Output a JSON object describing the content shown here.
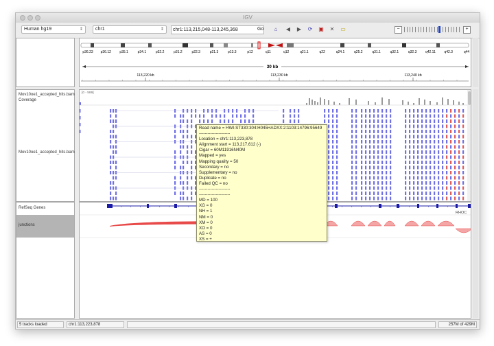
{
  "window": {
    "title": "IGV"
  },
  "toolbar": {
    "genome": "Human hg19",
    "chromosome": "chr1",
    "locus": "chr1:113,215,048-113,245,368",
    "go_label": "Go",
    "zoom_minus": "−",
    "zoom_plus": "+"
  },
  "ruler": {
    "bands": [
      "p36.23",
      "p36.12",
      "p35.1",
      "p34.1",
      "p32.2",
      "p31.2",
      "p22.3",
      "p21.3",
      "p13.3",
      "p12",
      "q11",
      "q12",
      "q21.1",
      "q22",
      "q24.1",
      "q25.2",
      "q31.1",
      "q32.1",
      "q32.3",
      "q42.11",
      "q42.3",
      "q44"
    ],
    "span_label": "30 kb",
    "ticks": [
      "113,220 kb",
      "113,230 kb",
      "113,240 kb"
    ]
  },
  "tracks": {
    "coverage_name": "Mov10oe1_accepted_hits.bam Coverage",
    "coverage_range": "[0 - 589]",
    "alignment_name": "Mov10oe1_accepted_hits.bam",
    "refseq_name": "RefSeq Genes",
    "junctions_name": "junctions",
    "gene_label": "RHOC"
  },
  "popup": {
    "lines": [
      "Read name = HWI-ST330:304:H045HADXX:2:1103:14796:95649",
      "----------------------",
      "Location = chr1:113,223,878",
      "Alignment start = 113,217,612 (-)",
      "Cigar = 60M11916N40M",
      "Mapped = yes",
      "Mapping quality = 50",
      "Secondary = no",
      "Supplementary = no",
      "Duplicate = no",
      "Failed QC = no",
      "----------------------",
      "----------------------",
      "MD = 100",
      "XG = 0",
      "NH = 1",
      "NM = 0",
      "XM = 0",
      "XO = 0",
      "AS = 0",
      "XS = +",
      "-------------------"
    ]
  },
  "status": {
    "tracks_loaded": "5 tracks loaded",
    "position": "chr1:113,223,878",
    "memory": "257M of 429M"
  },
  "colors": {
    "reads": "#6f6fe6",
    "reads_red": "#e05a5a",
    "gene": "#1a1aa6",
    "junction": "#e84a4a",
    "popup_bg": "#ffffcc"
  }
}
